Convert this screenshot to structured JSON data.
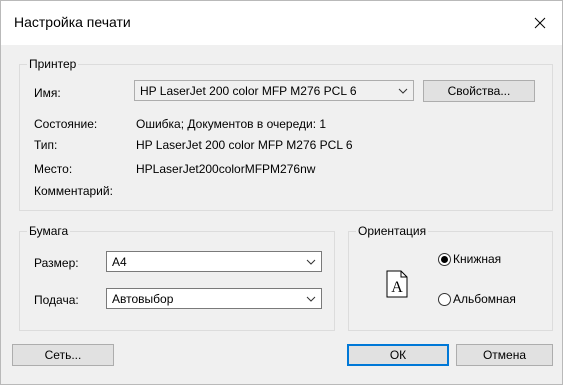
{
  "dialog": {
    "title": "Настройка печати"
  },
  "printer": {
    "legend": "Принтер",
    "name_label": "Имя:",
    "name_value": "HP LaserJet 200 color MFP M276 PCL 6",
    "properties_button": "Свойства...",
    "status_label": "Состояние:",
    "status_value": "Ошибка; Документов в очереди: 1",
    "type_label": "Тип:",
    "type_value": "HP LaserJet 200 color MFP M276 PCL 6",
    "location_label": "Место:",
    "location_value": "HPLaserJet200colorMFPM276nw",
    "comment_label": "Комментарий:"
  },
  "paper": {
    "legend": "Бумага",
    "size_label": "Размер:",
    "size_value": "A4",
    "source_label": "Подача:",
    "source_value": "Автовыбор"
  },
  "orientation": {
    "legend": "Ориентация",
    "icon_letter": "A",
    "portrait_label": "Книжная",
    "landscape_label": "Альбомная",
    "selected": "portrait"
  },
  "buttons": {
    "network": "Сеть...",
    "ok": "ОК",
    "cancel": "Отмена"
  },
  "colors": {
    "accent": "#0078d7",
    "dialog_bg": "#f0f0f0"
  }
}
